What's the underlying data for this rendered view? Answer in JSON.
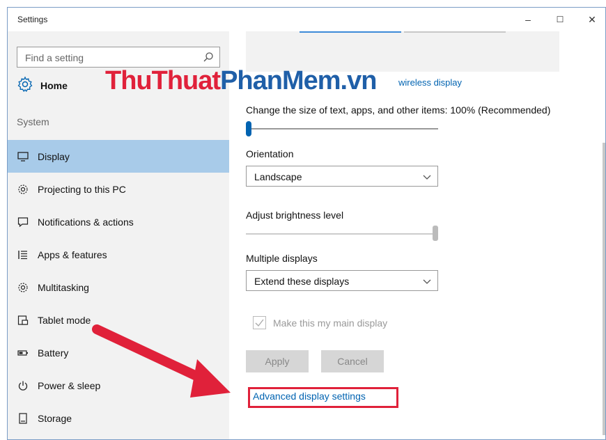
{
  "window": {
    "title": "Settings",
    "controls": {
      "minimize": "–",
      "maximize": "☐",
      "close": "✕"
    }
  },
  "watermark": {
    "part1": "ThuThuat",
    "part2": "PhanMem",
    "part3": ".vn"
  },
  "sidebar": {
    "search_placeholder": "Find a setting",
    "home_label": "Home",
    "section_label": "System",
    "items": [
      {
        "label": "Display",
        "icon": "monitor-icon",
        "active": true
      },
      {
        "label": "Projecting to this PC",
        "icon": "gear-icon",
        "active": false
      },
      {
        "label": "Notifications & actions",
        "icon": "speech-bubble-icon",
        "active": false
      },
      {
        "label": "Apps & features",
        "icon": "list-icon",
        "active": false
      },
      {
        "label": "Multitasking",
        "icon": "gear-icon",
        "active": false
      },
      {
        "label": "Tablet mode",
        "icon": "tablet-icon",
        "active": false
      },
      {
        "label": "Battery",
        "icon": "battery-icon",
        "active": false
      },
      {
        "label": "Power & sleep",
        "icon": "power-icon",
        "active": false
      },
      {
        "label": "Storage",
        "icon": "storage-icon",
        "active": false
      }
    ]
  },
  "main": {
    "wireless_link": "wireless display",
    "scale_label": "Change the size of text, apps, and other items: 100% (Recommended)",
    "scale_value": 0,
    "orientation_label": "Orientation",
    "orientation_value": "Landscape",
    "brightness_label": "Adjust brightness level",
    "brightness_value": 1.0,
    "multiple_displays_label": "Multiple displays",
    "multiple_displays_value": "Extend these displays",
    "main_display_label": "Make this my main display",
    "apply_label": "Apply",
    "cancel_label": "Cancel",
    "advanced_link": "Advanced display settings"
  },
  "colors": {
    "accent": "#0063b1",
    "active_nav": "#a8cbe9",
    "annotation_red": "#e0213a"
  }
}
